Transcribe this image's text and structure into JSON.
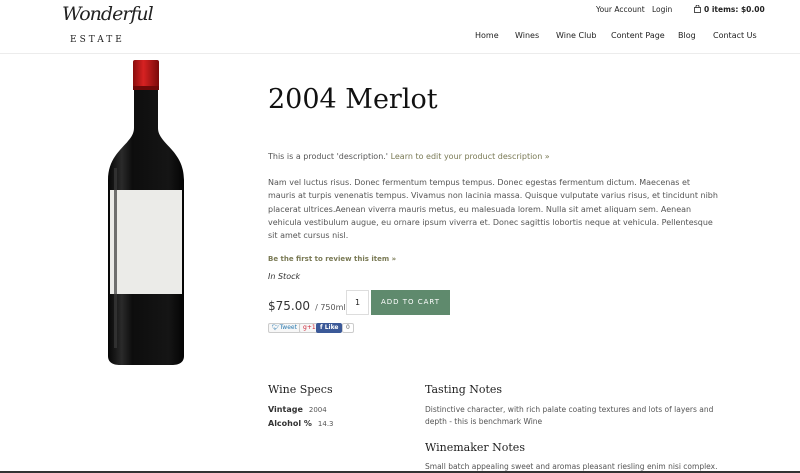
{
  "logo": {
    "script": "Wonderful",
    "estate": "ESTATE"
  },
  "header": {
    "account": "Your Account",
    "login": "Login",
    "cart": "0 items: $0.00"
  },
  "nav": [
    "Home",
    "Wines",
    "Wine Club",
    "Content Page",
    "Blog",
    "Contact Us"
  ],
  "product": {
    "title": "2004 Merlot",
    "description": "This is a product 'description.'",
    "description_link": "Learn to edit your product description »",
    "body": "Nam vel luctus risus. Donec fermentum tempus tempus. Donec egestas fermentum dictum. Maecenas et mauris at turpis venenatis tempus. Vivamus non lacinia massa. Quisque vulputate varius risus, et tincidunt nibh placerat ultrices.Aenean viverra mauris metus, eu malesuada lorem. Nulla sit amet aliquam sem. Aenean vehicula vestibulum augue, eu ornare ipsum viverra et. Donec sagittis lobortis neque at vehicula. Pellentesque sit amet cursus nisl.",
    "review_link": "Be the first to review this item »",
    "stock": "In Stock",
    "price": "$75.00",
    "unit": "/ 750ml",
    "quantity": "1",
    "add_to_cart": "ADD TO CART"
  },
  "social": {
    "tweet": "Tweet",
    "gplus": "+1",
    "like": "Like",
    "like_count": "0"
  },
  "specs": {
    "title": "Wine Specs",
    "vintage_label": "Vintage",
    "vintage": "2004",
    "alcohol_label": "Alcohol %",
    "alcohol": "14.3"
  },
  "tasting": {
    "title": "Tasting Notes",
    "text": "Distinctive character, with rich palate coating textures and lots of layers and depth - this is benchmark Wine"
  },
  "winemaker": {
    "title": "Winemaker Notes",
    "text": "Small batch appealing sweet and aromas pleasant riesling enim nisi complex."
  },
  "colors": {
    "accent": "#5f8a6d",
    "link": "#7a7a55",
    "bottle_cap": "#c41a1a"
  }
}
